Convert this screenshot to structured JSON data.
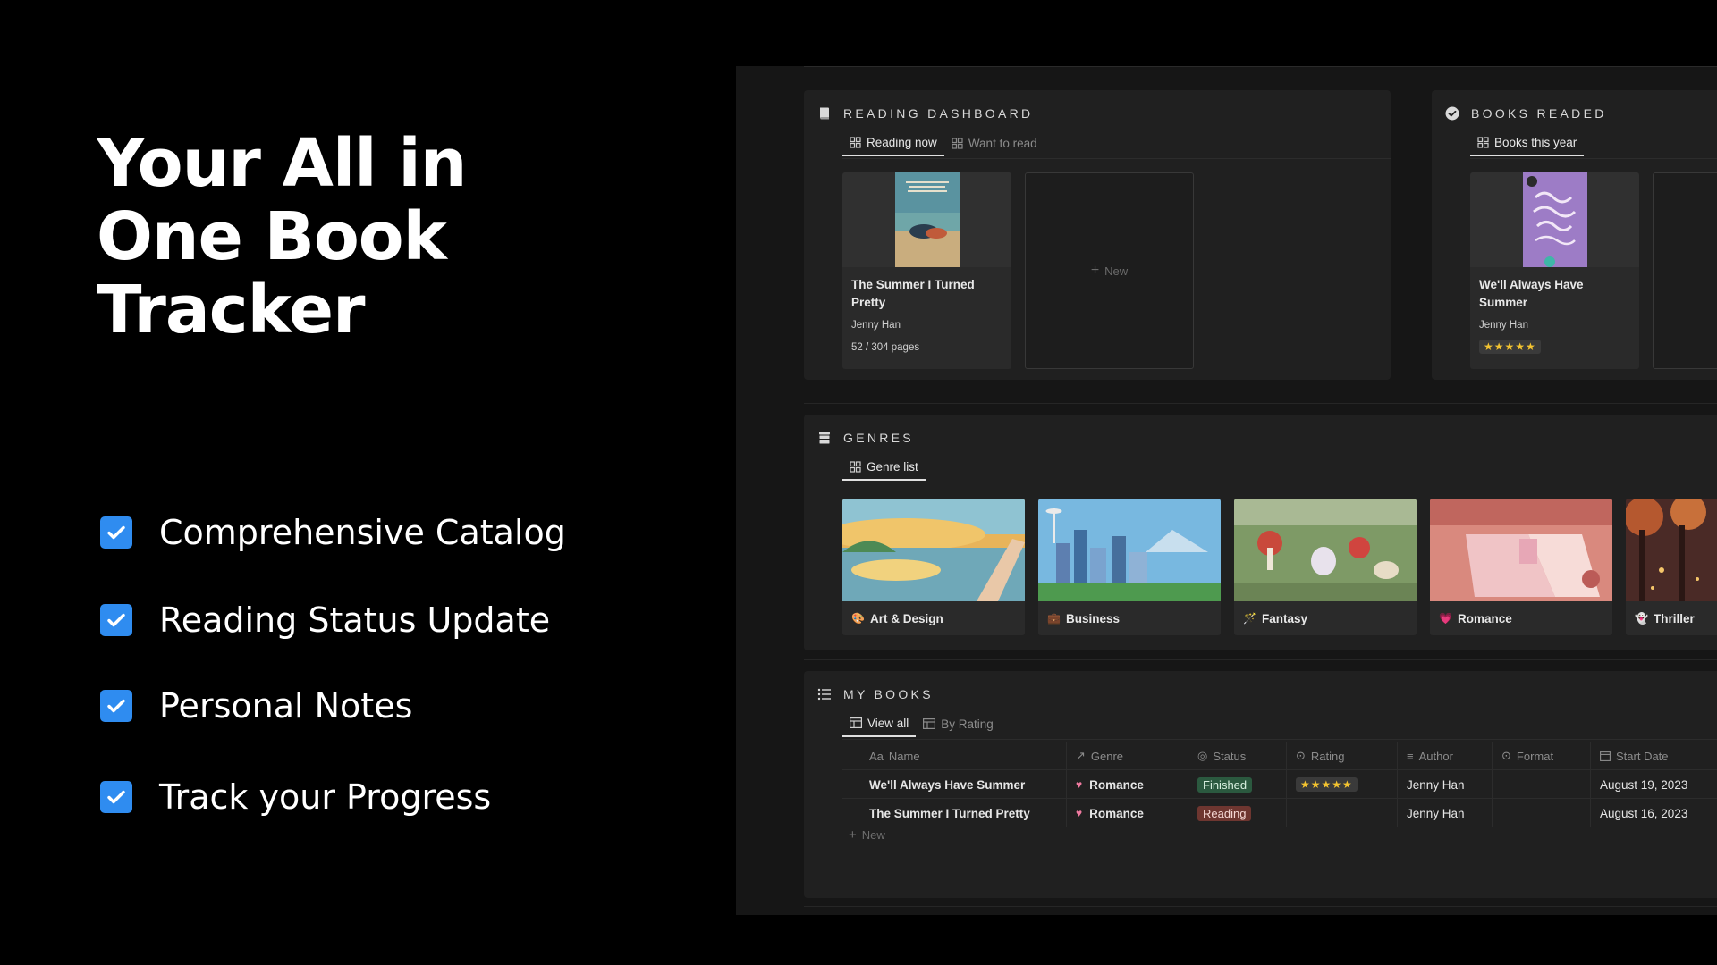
{
  "hero": {
    "title": "Your All in One Book Tracker"
  },
  "features": [
    {
      "label": "Comprehensive Catalog"
    },
    {
      "label": "Reading Status Update"
    },
    {
      "label": "Personal Notes"
    },
    {
      "label": "Track your Progress"
    }
  ],
  "dashboard": {
    "title": "READING DASHBOARD",
    "tabs": [
      {
        "label": "Reading now"
      },
      {
        "label": "Want to read"
      }
    ],
    "card": {
      "title": "The Summer I Turned Pretty",
      "author": "Jenny Han",
      "progress": "52 / 304 pages"
    },
    "new_label": "New"
  },
  "books_readed": {
    "title": "BOOKS READED",
    "tabs": [
      {
        "label": "Books this year"
      }
    ],
    "card": {
      "title": "We'll Always Have Summer",
      "author": "Jenny Han",
      "rating": "★★★★★"
    }
  },
  "genres": {
    "title": "GENRES",
    "tabs": [
      {
        "label": "Genre list"
      }
    ],
    "items": [
      {
        "label": "Art & Design",
        "emoji": "🎨"
      },
      {
        "label": "Business",
        "emoji": "💼"
      },
      {
        "label": "Fantasy",
        "emoji": "🪄"
      },
      {
        "label": "Romance",
        "emoji": "💗"
      },
      {
        "label": "Thriller",
        "emoji": "👻"
      }
    ]
  },
  "my_books": {
    "title": "MY BOOKS",
    "tabs": [
      {
        "label": "View all"
      },
      {
        "label": "By Rating"
      }
    ],
    "columns": [
      {
        "label": "Name",
        "icon": "Aa"
      },
      {
        "label": "Genre"
      },
      {
        "label": "Status"
      },
      {
        "label": "Rating"
      },
      {
        "label": "Author"
      },
      {
        "label": "Format"
      },
      {
        "label": "Start Date"
      }
    ],
    "rows": [
      {
        "name": "We'll Always Have Summer",
        "genre": "Romance",
        "status": "Finished",
        "rating": "★★★★★",
        "author": "Jenny Han",
        "format": "",
        "start": "August 19, 2023"
      },
      {
        "name": "The Summer I Turned Pretty",
        "genre": "Romance",
        "status": "Reading",
        "rating": "",
        "author": "Jenny Han",
        "format": "",
        "start": "August 16, 2023"
      }
    ],
    "new_label": "New"
  }
}
